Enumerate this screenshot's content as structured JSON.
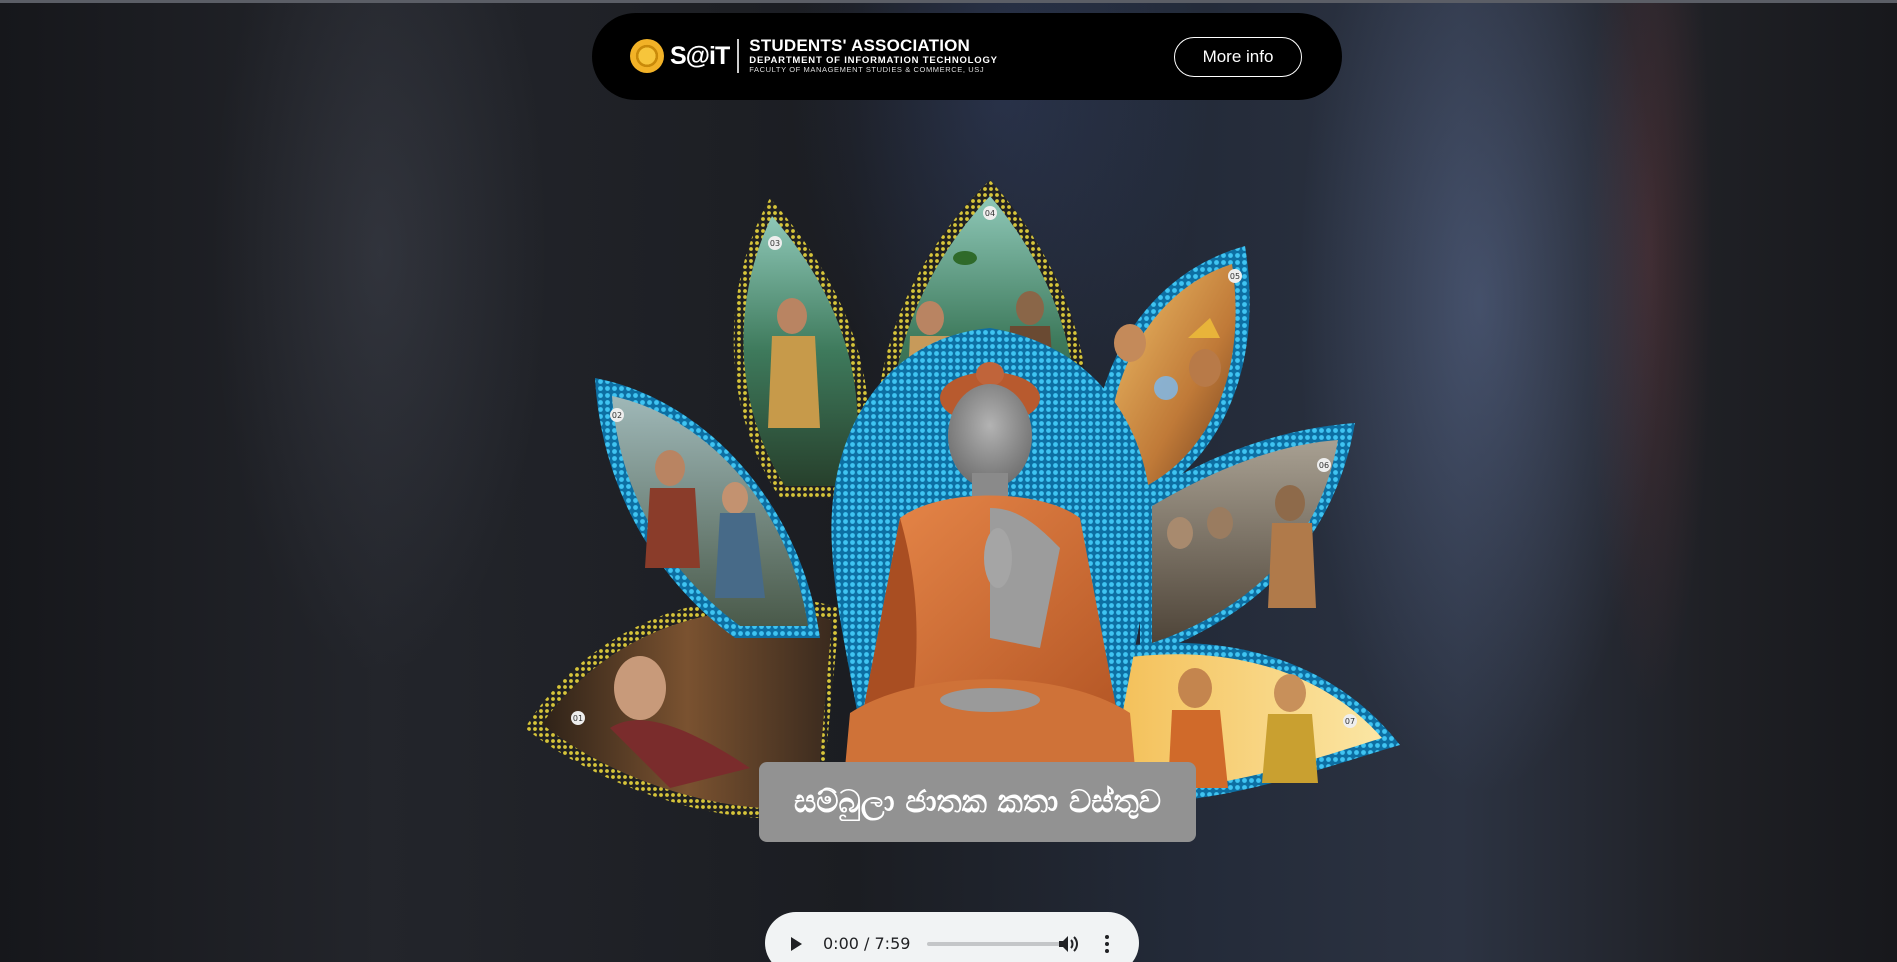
{
  "header": {
    "logo_text": "S@iT",
    "org_title": "STUDENTS' ASSOCIATION",
    "org_department": "DEPARTMENT OF INFORMATION TECHNOLOGY",
    "org_faculty": "FACULTY OF MANAGEMENT STUDIES & COMMERCE, USJ",
    "more_info_label": "More info"
  },
  "artwork": {
    "petal_numbers": [
      "01",
      "02",
      "03",
      "04",
      "05",
      "06",
      "07"
    ]
  },
  "story_title": "සම්බුලා ජාතක කතා වස්තුව",
  "audio_player": {
    "current_time": "0:00",
    "duration": "7:59",
    "time_display": "0:00 / 7:59",
    "progress": 0
  },
  "colors": {
    "header_bg": "#000000",
    "title_box_bg": "#929292",
    "halo_blue": "#29a9e0",
    "robe_orange": "#d9733a"
  }
}
